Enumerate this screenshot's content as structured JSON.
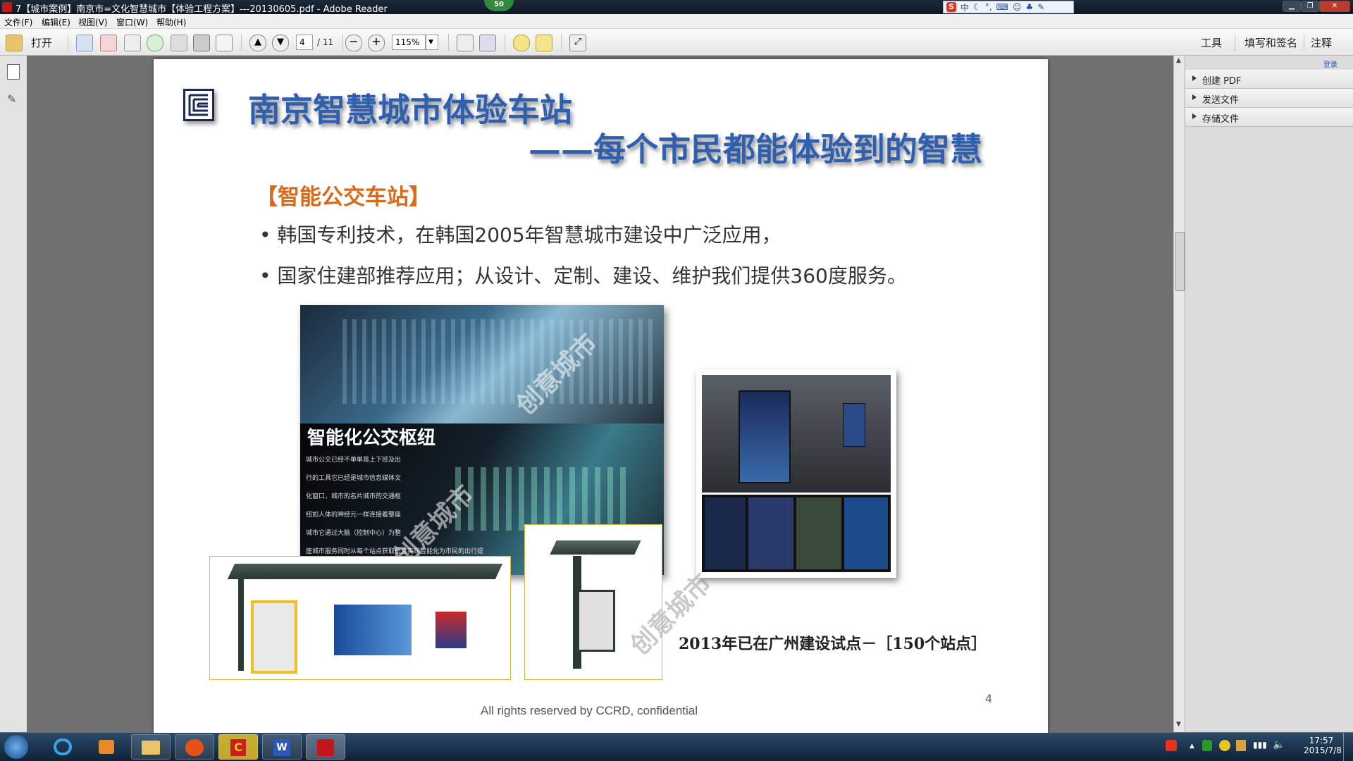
{
  "window": {
    "title": "7【城市案例】南京市=文化智慧城市【体验工程方案】---20130605.pdf - Adobe Reader",
    "badge": "50",
    "ime_label": "中",
    "ime_logo": "S"
  },
  "menu": [
    "文件(F)",
    "编辑(E)",
    "视图(V)",
    "窗口(W)",
    "帮助(H)"
  ],
  "toolbar": {
    "open_label": "打开",
    "page_current": "4",
    "page_total": "/ 11",
    "zoom": "115%",
    "tools_label": "工具",
    "sign_label": "填写和签名",
    "comment_label": "注释"
  },
  "right_pane": {
    "login": "登录",
    "items": [
      "创建 PDF",
      "发送文件",
      "存储文件"
    ]
  },
  "slide": {
    "title_main": "南京智慧城市体验车站",
    "title_sub": "——每个市民都能体验到的智慧",
    "section": "【智能公交车站】",
    "bullets": [
      "韩国专利技术，在韩国2005年智慧城市建设中广泛应用，",
      "国家住建部推荐应用；从设计、定制、建设、维护我们提供360度服务。"
    ],
    "photo_title": "智能化公交枢纽",
    "photo_text": [
      "城市公交已经不单单是上下班及出",
      "行的工具它已经是城市信息媒体文",
      "化窗口，城市的名片城市的交通枢",
      "纽如人体的神经元一样连接着整座",
      "城市它通过大脑（控制中心）为整",
      "座城市服务同时从每个站点获取信息实现智能化为市民的出行提"
    ],
    "watermark": "创意城市",
    "caption": "2013年已在广州建设试点－［150个站点］",
    "page_number": "4",
    "footer": "All rights reserved by CCRD, confidential"
  },
  "taskbar": {
    "time": "17:57",
    "date": "2015/7/8"
  }
}
